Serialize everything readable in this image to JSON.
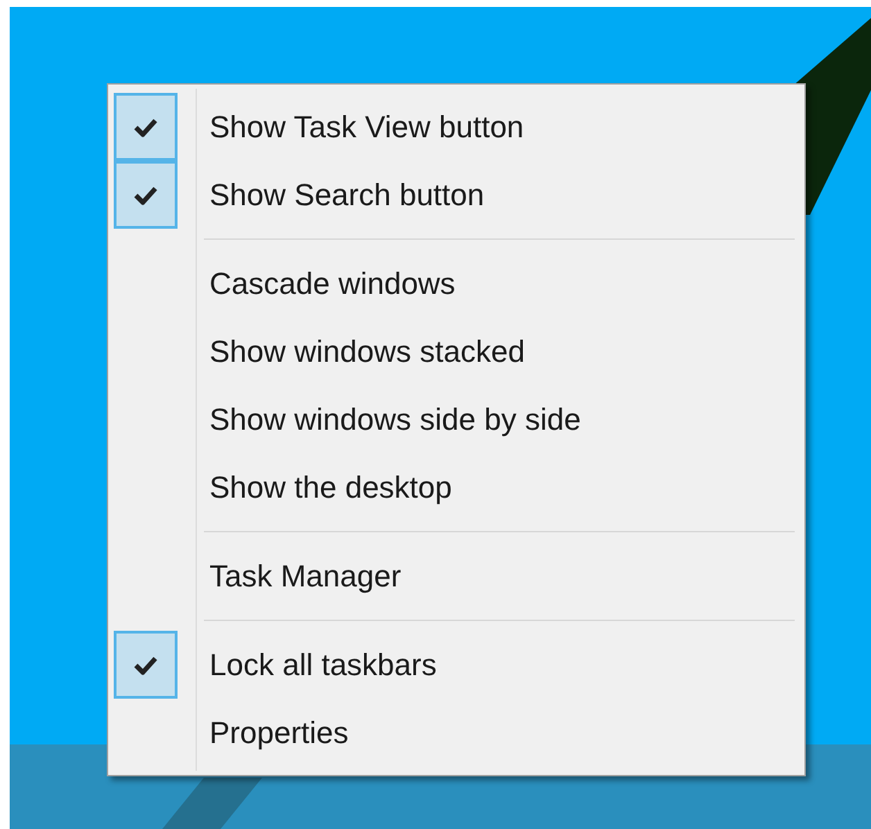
{
  "context_menu": {
    "groups": [
      {
        "items": [
          {
            "label": "Show Task View button",
            "checked": true
          },
          {
            "label": "Show Search button",
            "checked": true
          }
        ]
      },
      {
        "items": [
          {
            "label": "Cascade windows",
            "checked": false
          },
          {
            "label": "Show windows stacked",
            "checked": false
          },
          {
            "label": "Show windows side by side",
            "checked": false
          },
          {
            "label": "Show the desktop",
            "checked": false
          }
        ]
      },
      {
        "items": [
          {
            "label": "Task Manager",
            "checked": false
          }
        ]
      },
      {
        "items": [
          {
            "label": "Lock all taskbars",
            "checked": true
          },
          {
            "label": "Properties",
            "checked": false
          }
        ]
      }
    ]
  }
}
